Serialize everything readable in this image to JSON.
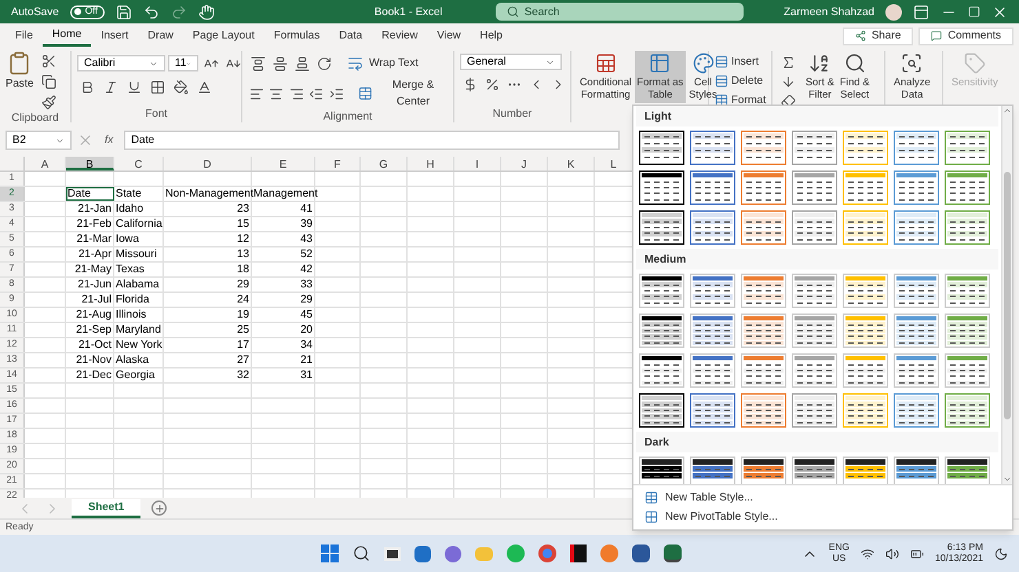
{
  "title_bar": {
    "autosave_label": "AutoSave",
    "autosave_state": "Off",
    "autosave_on": false,
    "title": "Book1 - Excel",
    "search_placeholder": "Search",
    "user": "Zarmeen Shahzad"
  },
  "menu_tabs": [
    {
      "label": "File",
      "selected": false
    },
    {
      "label": "Home",
      "selected": true
    },
    {
      "label": "Insert",
      "selected": false
    },
    {
      "label": "Draw",
      "selected": false
    },
    {
      "label": "Page Layout",
      "selected": false
    },
    {
      "label": "Formulas",
      "selected": false
    },
    {
      "label": "Data",
      "selected": false
    },
    {
      "label": "Review",
      "selected": false
    },
    {
      "label": "View",
      "selected": false
    },
    {
      "label": "Help",
      "selected": false
    }
  ],
  "share": "Share",
  "comments": "Comments",
  "ribbon": {
    "clipboard": {
      "paste": "Paste",
      "label": "Clipboard"
    },
    "font": {
      "font_name": "Calibri",
      "font_size": "11",
      "label": "Font"
    },
    "alignment": {
      "wrap": "Wrap Text",
      "merge": "Merge & Center",
      "label": "Alignment"
    },
    "number": {
      "format": "General",
      "label": "Number"
    },
    "styles": [
      {
        "lines": [
          "Conditional",
          "Formatting"
        ],
        "kind": "conditional",
        "selected": false
      },
      {
        "lines": [
          "Format as",
          "Table"
        ],
        "kind": "table",
        "selected": true
      },
      {
        "lines": [
          "Cell",
          "Styles"
        ],
        "kind": "cell",
        "selected": false
      }
    ],
    "cells": [
      {
        "label": "Insert",
        "kind": "insert"
      },
      {
        "label": "Delete",
        "kind": "delete"
      },
      {
        "label": "Format",
        "kind": "format"
      }
    ],
    "editing": [
      {
        "lines": [
          "Sort &",
          "Filter"
        ],
        "kind": "sort"
      },
      {
        "lines": [
          "Find &",
          "Select"
        ],
        "kind": "find"
      }
    ],
    "analyze": {
      "lines": [
        "Analyze",
        "Data"
      ]
    },
    "sensitivity": {
      "label": "Sensitivity",
      "disabled": true
    }
  },
  "formula_bar": {
    "name_box": "B2",
    "fx": "fx",
    "value": "Date"
  },
  "sheet": {
    "columns": [
      "A",
      "B",
      "C",
      "D",
      "E",
      "F",
      "G",
      "H",
      "I",
      "J",
      "K",
      "L"
    ],
    "rows": [
      {
        "number": "1",
        "cells": []
      },
      {
        "number": "2",
        "cells": [
          {
            "text": ""
          },
          {
            "text": "Date",
            "kind": "text",
            "selected": true
          },
          {
            "text": "State",
            "kind": "text",
            "selected": false
          },
          {
            "text": "Non-Management",
            "kind": "text",
            "selected": false
          },
          {
            "text": "Management",
            "kind": "text",
            "selected": false
          }
        ]
      },
      {
        "number": "3",
        "cells": [
          {
            "text": ""
          },
          {
            "text": "21-Jan",
            "kind": "number",
            "selected": false
          },
          {
            "text": "Idaho",
            "kind": "text",
            "selected": false
          },
          {
            "text": "23",
            "kind": "number",
            "selected": false
          },
          {
            "text": "41",
            "kind": "number",
            "selected": false
          }
        ]
      },
      {
        "number": "4",
        "cells": [
          {
            "text": ""
          },
          {
            "text": "21-Feb",
            "kind": "number",
            "selected": false
          },
          {
            "text": "California",
            "kind": "text",
            "selected": false
          },
          {
            "text": "15",
            "kind": "number",
            "selected": false
          },
          {
            "text": "39",
            "kind": "number",
            "selected": false
          }
        ]
      },
      {
        "number": "5",
        "cells": [
          {
            "text": ""
          },
          {
            "text": "21-Mar",
            "kind": "number",
            "selected": false
          },
          {
            "text": "Iowa",
            "kind": "text",
            "selected": false
          },
          {
            "text": "12",
            "kind": "number",
            "selected": false
          },
          {
            "text": "43",
            "kind": "number",
            "selected": false
          }
        ]
      },
      {
        "number": "6",
        "cells": [
          {
            "text": ""
          },
          {
            "text": "21-Apr",
            "kind": "number",
            "selected": false
          },
          {
            "text": "Missouri",
            "kind": "text",
            "selected": false
          },
          {
            "text": "13",
            "kind": "number",
            "selected": false
          },
          {
            "text": "52",
            "kind": "number",
            "selected": false
          }
        ]
      },
      {
        "number": "7",
        "cells": [
          {
            "text": ""
          },
          {
            "text": "21-May",
            "kind": "number",
            "selected": false
          },
          {
            "text": "Texas",
            "kind": "text",
            "selected": false
          },
          {
            "text": "18",
            "kind": "number",
            "selected": false
          },
          {
            "text": "42",
            "kind": "number",
            "selected": false
          }
        ]
      },
      {
        "number": "8",
        "cells": [
          {
            "text": ""
          },
          {
            "text": "21-Jun",
            "kind": "number",
            "selected": false
          },
          {
            "text": "Alabama",
            "kind": "text",
            "selected": false
          },
          {
            "text": "29",
            "kind": "number",
            "selected": false
          },
          {
            "text": "33",
            "kind": "number",
            "selected": false
          }
        ]
      },
      {
        "number": "9",
        "cells": [
          {
            "text": ""
          },
          {
            "text": "21-Jul",
            "kind": "number",
            "selected": false
          },
          {
            "text": "Florida",
            "kind": "text",
            "selected": false
          },
          {
            "text": "24",
            "kind": "number",
            "selected": false
          },
          {
            "text": "29",
            "kind": "number",
            "selected": false
          }
        ]
      },
      {
        "number": "10",
        "cells": [
          {
            "text": ""
          },
          {
            "text": "21-Aug",
            "kind": "number",
            "selected": false
          },
          {
            "text": "Illinois",
            "kind": "text",
            "selected": false
          },
          {
            "text": "19",
            "kind": "number",
            "selected": false
          },
          {
            "text": "45",
            "kind": "number",
            "selected": false
          }
        ]
      },
      {
        "number": "11",
        "cells": [
          {
            "text": ""
          },
          {
            "text": "21-Sep",
            "kind": "number",
            "selected": false
          },
          {
            "text": "Maryland",
            "kind": "text",
            "selected": false
          },
          {
            "text": "25",
            "kind": "number",
            "selected": false
          },
          {
            "text": "20",
            "kind": "number",
            "selected": false
          }
        ]
      },
      {
        "number": "12",
        "cells": [
          {
            "text": ""
          },
          {
            "text": "21-Oct",
            "kind": "number",
            "selected": false
          },
          {
            "text": "New York",
            "kind": "text",
            "selected": false
          },
          {
            "text": "17",
            "kind": "number",
            "selected": false
          },
          {
            "text": "34",
            "kind": "number",
            "selected": false
          }
        ]
      },
      {
        "number": "13",
        "cells": [
          {
            "text": ""
          },
          {
            "text": "21-Nov",
            "kind": "number",
            "selected": false
          },
          {
            "text": "Alaska",
            "kind": "text",
            "selected": false
          },
          {
            "text": "27",
            "kind": "number",
            "selected": false
          },
          {
            "text": "21",
            "kind": "number",
            "selected": false
          }
        ]
      },
      {
        "number": "14",
        "cells": [
          {
            "text": ""
          },
          {
            "text": "21-Dec",
            "kind": "number",
            "selected": false
          },
          {
            "text": "Georgia",
            "kind": "text",
            "selected": false
          },
          {
            "text": "32",
            "kind": "number",
            "selected": false
          },
          {
            "text": "31",
            "kind": "number",
            "selected": false
          }
        ]
      },
      {
        "number": "15",
        "cells": []
      },
      {
        "number": "16",
        "cells": []
      },
      {
        "number": "17",
        "cells": []
      },
      {
        "number": "18",
        "cells": []
      },
      {
        "number": "19",
        "cells": []
      },
      {
        "number": "20",
        "cells": []
      },
      {
        "number": "21",
        "cells": []
      },
      {
        "number": "22",
        "cells": []
      }
    ]
  },
  "gallery": {
    "sections": [
      {
        "title": "Light",
        "kind": "light"
      },
      {
        "title": "Medium",
        "kind": "medium"
      },
      {
        "title": "Dark",
        "kind": "dark"
      }
    ],
    "actions": [
      {
        "label": "New Table Style...",
        "kind": "table"
      },
      {
        "label": "New PivotTable Style...",
        "kind": "pivot"
      }
    ]
  },
  "sheet_tabs": [
    {
      "label": "Sheet1",
      "selected": true
    }
  ],
  "status_bar": {
    "text": "Ready"
  },
  "taskbar": {
    "language": "ENG",
    "region": "US",
    "time": "6:13 PM",
    "date": "10/13/2021"
  }
}
